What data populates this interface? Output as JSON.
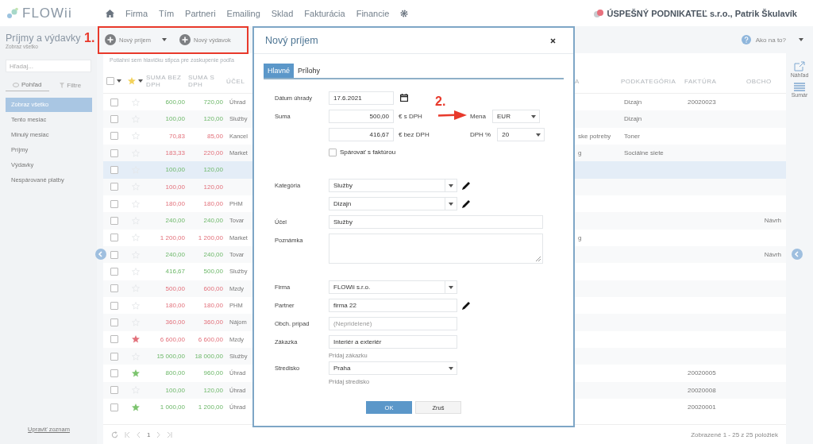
{
  "nav": {
    "logo": "FLOWii",
    "items": [
      "Firma",
      "Tím",
      "Partneri",
      "Emailing",
      "Sklad",
      "Fakturácia",
      "Financie"
    ],
    "account": "ÚSPEŠNÝ PODNIKATEĽ s.r.o., Patrik Škulavík"
  },
  "sidebar": {
    "title": "Príjmy a výdavky",
    "subtitle": "Zobraz všetko",
    "search": {
      "placeholder": "Hľadaj..."
    },
    "tabs": [
      {
        "label": "Pohľad",
        "selected": true
      },
      {
        "label": "Filtre",
        "selected": false
      }
    ],
    "items": [
      {
        "label": "Zobraz všetko",
        "selected": true
      },
      {
        "label": "Tento mesiac",
        "selected": false
      },
      {
        "label": "Minulý mesiac",
        "selected": false
      },
      {
        "label": "Príjmy",
        "selected": false
      },
      {
        "label": "Výdavky",
        "selected": false
      },
      {
        "label": "Nespárované platby",
        "selected": false
      }
    ],
    "footer_link": "Upraviť zoznam"
  },
  "toolbar": {
    "buttons": [
      {
        "label": "Nový príjem",
        "dropdown": true
      },
      {
        "label": "Nový výdavok",
        "dropdown": false
      }
    ],
    "help": "Ako na to?"
  },
  "annotations": [
    {
      "label": "1."
    },
    {
      "label": "2."
    }
  ],
  "table": {
    "group_hint": "Potiahni sem hlavičku stĺpca pre zoskupenie podľa",
    "select_all": {
      "checked": false
    },
    "columns": [
      "SUMA BEZ DPH",
      "SUMA S DPH",
      "ÚČEL",
      "A",
      "PODKATEGÓRIA",
      "FAKTÚRA",
      "OBCHO"
    ],
    "rows": [
      {
        "kind": "income",
        "starred": false,
        "net": "600,00",
        "gross": "720,00",
        "purpose": "Úhrad",
        "subcategory": "Dizajn",
        "invoice": "20020023",
        "selected": false
      },
      {
        "kind": "income",
        "starred": false,
        "net": "100,00",
        "gross": "120,00",
        "purpose": "Služby",
        "subcategory": "Dizajn",
        "selected": false
      },
      {
        "kind": "expense",
        "starred": false,
        "net": "70,83",
        "gross": "85,00",
        "purpose": "Kancel",
        "column_4": "ske potreby",
        "subcategory": "Toner",
        "selected": false
      },
      {
        "kind": "expense",
        "starred": false,
        "net": "183,33",
        "gross": "220,00",
        "purpose": "Market",
        "column_4": "g",
        "subcategory": "Sociálne siete",
        "selected": false
      },
      {
        "kind": "income",
        "starred": false,
        "net": "100,00",
        "gross": "120,00",
        "selected": true
      },
      {
        "kind": "expense",
        "starred": false,
        "net": "100,00",
        "gross": "120,00",
        "selected": false
      },
      {
        "kind": "expense",
        "starred": false,
        "net": "180,00",
        "gross": "180,00",
        "purpose": "PHM",
        "selected": false
      },
      {
        "kind": "income",
        "starred": false,
        "net": "240,00",
        "gross": "240,00",
        "purpose": "Tovar",
        "deal": "Návrh",
        "selected": false
      },
      {
        "kind": "expense",
        "starred": false,
        "net": "1 200,00",
        "gross": "1 200,00",
        "purpose": "Market",
        "column_4": "g",
        "selected": false
      },
      {
        "kind": "income",
        "starred": false,
        "net": "240,00",
        "gross": "240,00",
        "purpose": "Tovar",
        "deal": "Návrh",
        "selected": false
      },
      {
        "kind": "income",
        "starred": false,
        "net": "416,67",
        "gross": "500,00",
        "purpose": "Služby",
        "selected": false
      },
      {
        "kind": "expense",
        "starred": false,
        "net": "500,00",
        "gross": "600,00",
        "purpose": "Mzdy",
        "selected": false
      },
      {
        "kind": "expense",
        "starred": false,
        "net": "180,00",
        "gross": "180,00",
        "purpose": "PHM",
        "selected": false
      },
      {
        "kind": "expense",
        "starred": false,
        "net": "360,00",
        "gross": "360,00",
        "purpose": "Nájom",
        "selected": false
      },
      {
        "kind": "expense",
        "starred": true,
        "color": "#e2707a",
        "net": "6 600,00",
        "gross": "6 600,00",
        "purpose": "Mzdy",
        "selected": false
      },
      {
        "kind": "income",
        "starred": false,
        "net": "15 000,00",
        "gross": "18 000,00",
        "purpose": "Služby",
        "selected": false
      },
      {
        "kind": "income",
        "starred": true,
        "color": "#7cc46e",
        "net": "800,00",
        "gross": "960,00",
        "purpose": "Úhrad",
        "invoice": "20020005",
        "selected": false
      },
      {
        "kind": "income",
        "starred": false,
        "net": "100,00",
        "gross": "120,00",
        "purpose": "Úhrad",
        "invoice": "20020008",
        "selected": false
      },
      {
        "kind": "income",
        "starred": true,
        "color": "#7cc46e",
        "net": "1 000,00",
        "gross": "1 200,00",
        "purpose": "Úhrad",
        "invoice": "20020001",
        "selected": false
      }
    ]
  },
  "pagination": {
    "page": "1",
    "summary": "Zobrazené 1 - 25 z 25 položiek"
  },
  "rail": [
    {
      "label": "Náhľad"
    },
    {
      "label": "Sumár"
    }
  ],
  "dialog": {
    "title": "Nový príjem",
    "tabs": [
      {
        "label": "Hlavné",
        "selected": true
      },
      {
        "label": "Prílohy",
        "selected": false
      }
    ],
    "date": {
      "label": "Dátum úhrady",
      "value": "17.6.2021"
    },
    "amount": {
      "label": "Suma",
      "gross": "500,00",
      "gross_unit": "€ s DPH",
      "net": "416,67",
      "net_unit": "€ bez DPH"
    },
    "currency": {
      "label": "Mena",
      "value": "EUR"
    },
    "vat": {
      "label": "DPH %",
      "value": "20"
    },
    "pair": {
      "label": "Spárovať s faktúrou",
      "checked": false
    },
    "sections": [
      [
        {
          "kind": "select",
          "label": "Kategória",
          "value": "Služby",
          "editable": true
        },
        {
          "kind": "select",
          "value": "Dizajn",
          "editable": true
        },
        {
          "kind": "long-input",
          "label": "Účel",
          "value": "Služby"
        },
        {
          "kind": "textarea",
          "label": "Poznámka"
        }
      ],
      [
        {
          "kind": "select",
          "label": "Firma",
          "value": "FLOWii s.r.o.",
          "editable": false
        },
        {
          "kind": "input",
          "label": "Partner",
          "value": "firma 22",
          "editable": true
        },
        {
          "kind": "input",
          "label": "Obch. prípad",
          "placeholder": "(Nepridelené)",
          "editable": false
        },
        {
          "kind": "input",
          "label": "Zákazka",
          "value": "Interiér a exteriér",
          "editable": false,
          "link": "Pridaj zákazku"
        },
        {
          "kind": "plain-select",
          "label": "Stredisko",
          "value": "Praha",
          "link": "Pridaj stredisko"
        }
      ]
    ],
    "buttons": [
      {
        "label": "OK",
        "kind": "primary"
      },
      {
        "label": "Zruš",
        "kind": "secondary"
      }
    ]
  }
}
